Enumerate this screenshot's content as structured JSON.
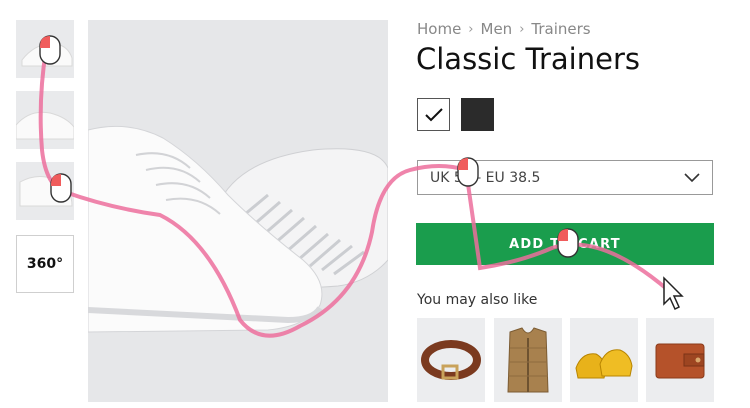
{
  "thumbnails": {
    "view360_label": "360°"
  },
  "breadcrumb": [
    "Home",
    "Men",
    "Trainers"
  ],
  "product": {
    "title": "Classic Trainers",
    "colors": [
      {
        "name": "white",
        "hex": "#ffffff",
        "selected": true
      },
      {
        "name": "black",
        "hex": "#2b2b2b",
        "selected": false
      }
    ],
    "size_selected": "UK 5 — EU 38.5",
    "add_to_cart_label": "ADD TO CART"
  },
  "recommendations": {
    "heading": "You may also like",
    "items": [
      {
        "icon": "belt-icon"
      },
      {
        "icon": "vest-icon"
      },
      {
        "icon": "yellow-shoes-icon"
      },
      {
        "icon": "wallet-icon"
      }
    ]
  },
  "colors": {
    "accent": "#1a9d4d",
    "mouse_path": "#ec6f9c"
  }
}
